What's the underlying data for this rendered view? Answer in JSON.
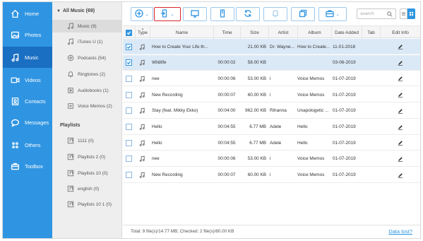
{
  "sidebar": {
    "items": [
      {
        "label": "Home",
        "icon": "home-icon"
      },
      {
        "label": "Photos",
        "icon": "photo-icon"
      },
      {
        "label": "Music",
        "icon": "music-icon",
        "active": true
      },
      {
        "label": "Videos",
        "icon": "video-icon"
      },
      {
        "label": "Contacts",
        "icon": "contacts-icon"
      },
      {
        "label": "Messages",
        "icon": "messages-icon"
      },
      {
        "label": "Others",
        "icon": "others-icon"
      },
      {
        "label": "Toolbox",
        "icon": "toolbox-icon"
      }
    ]
  },
  "categories": {
    "header": "All Music (69)",
    "items": [
      {
        "label": "Music (9)",
        "icon": "music-note-icon",
        "active": true
      },
      {
        "label": "iTunes U (1)",
        "icon": "itunes-u-icon"
      },
      {
        "label": "Podcasts (54)",
        "icon": "podcast-icon"
      },
      {
        "label": "Ringtones (2)",
        "icon": "bell-icon"
      },
      {
        "label": "Audiobooks (1)",
        "icon": "audiobook-icon"
      },
      {
        "label": "Voice Memos (2)",
        "icon": "voice-memo-icon"
      }
    ],
    "playlists_title": "Playlists",
    "playlists": [
      {
        "label": "1111 (0)"
      },
      {
        "label": "Playlists 2 (0)"
      },
      {
        "label": "Playlists 10 (0)"
      },
      {
        "label": "english (0)"
      },
      {
        "label": "Playlists 10 1 (0)"
      }
    ]
  },
  "toolbar": {
    "search_placeholder": "search",
    "buttons": [
      "add",
      "transfer-to-device",
      "transfer-to-pc",
      "export-to-device",
      "refresh",
      "ringtone",
      "duplicate",
      "toolbox"
    ]
  },
  "table": {
    "columns": [
      "Type",
      "Name",
      "Time",
      "Size",
      "Artist",
      "Album",
      "Date Added",
      "Tab",
      "Edit Info"
    ],
    "rows": [
      {
        "name": "How to Create Your Life th...",
        "time": "",
        "size": "21.00 KB",
        "artist": "Dr. Wayne...",
        "album": "How to Create...",
        "date": "11-01-2018",
        "selected": true
      },
      {
        "name": "Wildlife",
        "time": "00:00:02",
        "size": "58.00 KB",
        "artist": "",
        "album": "",
        "date": "03-06-2019",
        "selected": true
      },
      {
        "name": "nee",
        "time": "00:00:06",
        "size": "53.00 KB",
        "artist": "i",
        "album": "Voice Memos",
        "date": "01-07-2019",
        "selected": false
      },
      {
        "name": "New Recording",
        "time": "00:00:07",
        "size": "60.00 KB",
        "artist": "i",
        "album": "Voice Memos",
        "date": "01-07-2019",
        "selected": false
      },
      {
        "name": "Stay (feat. Mikky Ekko)",
        "time": "00:04:00",
        "size": "962.00 KB",
        "artist": "Rihanna",
        "album": "Unapologetic ...",
        "date": "01-07-2019",
        "selected": false
      },
      {
        "name": "Hello",
        "time": "00:04:55",
        "size": "6.77 MB",
        "artist": "Adele",
        "album": "Hello",
        "date": "01-07-2019",
        "selected": false
      },
      {
        "name": "Hello",
        "time": "00:04:55",
        "size": "6.77 MB",
        "artist": "Adele",
        "album": "Hello",
        "date": "01-07-2019",
        "selected": false
      },
      {
        "name": "nee",
        "time": "00:00:06",
        "size": "53.00 KB",
        "artist": "i",
        "album": "Voice Memos",
        "date": "01-07-2019",
        "selected": false
      },
      {
        "name": "New Recording",
        "time": "00:00:07",
        "size": "60.00 KB",
        "artist": "i",
        "album": "Voice Memos",
        "date": "01-07-2019",
        "selected": false
      }
    ]
  },
  "footer": {
    "status": "Total: 9 file(s)/14.77 MB; Checked: 2 file(s)/80.00 KB",
    "link": "Data lost?"
  },
  "colors": {
    "accent": "#2f95e2",
    "sidebar_active": "#1a6fc2",
    "highlight_border": "#d9262b",
    "row_selected": "#dbe9f7"
  }
}
